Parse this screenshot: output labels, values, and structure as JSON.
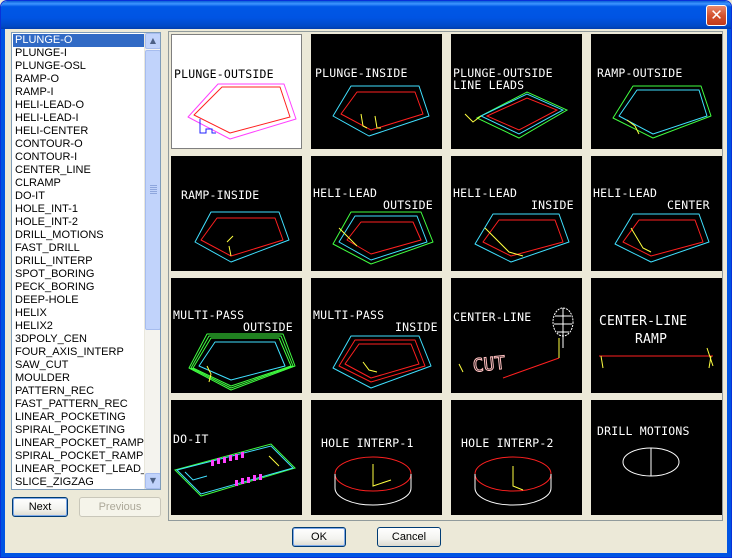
{
  "window": {
    "close_glyph": "✕"
  },
  "list": {
    "items": [
      "PLUNGE-O",
      "PLUNGE-I",
      "PLUNGE-OSL",
      "RAMP-O",
      "RAMP-I",
      "HELI-LEAD-O",
      "HELI-LEAD-I",
      "HELI-CENTER",
      "CONTOUR-O",
      "CONTOUR-I",
      "CENTER_LINE",
      "CLRAMP",
      "DO-IT",
      "HOLE_INT-1",
      "HOLE_INT-2",
      "DRILL_MOTIONS",
      "FAST_DRILL",
      "DRILL_INTERP",
      "SPOT_BORING",
      "PECK_BORING",
      "DEEP-HOLE",
      "HELIX",
      "HELIX2",
      "3DPOLY_CEN",
      "FOUR_AXIS_INTERP",
      "SAW_CUT",
      "MOULDER",
      "PATTERN_REC",
      "FAST_PATTERN_REC",
      "LINEAR_POCKETING",
      "SPIRAL_POCKETING",
      "LINEAR_POCKET_RAMP",
      "SPIRAL_POCKET_RAMP",
      "LINEAR_POCKET_LEAD_",
      "SLICE_ZIGZAG"
    ],
    "selected": "PLUNGE-O",
    "scroll_up_icon": "▲",
    "scroll_down_icon": "▼"
  },
  "buttons": {
    "next": "Next",
    "previous": "Previous",
    "ok": "OK",
    "cancel": "Cancel"
  },
  "tiles": {
    "plunge_outside": "PLUNGE-OUTSIDE",
    "plunge_inside": "PLUNGE-INSIDE",
    "plunge_outside_line_leads_1": "PLUNGE-OUTSIDE",
    "plunge_outside_line_leads_2": "LINE LEADS",
    "ramp_outside": "RAMP-OUTSIDE",
    "ramp_inside": "RAMP-INSIDE",
    "heli_lead_outside_1": "HELI-LEAD",
    "heli_lead_outside_2": "OUTSIDE",
    "heli_lead_inside_1": "HELI-LEAD",
    "heli_lead_inside_2": "INSIDE",
    "heli_lead_center_1": "HELI-LEAD",
    "heli_lead_center_2": "CENTER",
    "multi_pass_outside_1": "MULTI-PASS",
    "multi_pass_outside_2": "OUTSIDE",
    "multi_pass_inside_1": "MULTI-PASS",
    "multi_pass_inside_2": "INSIDE",
    "center_line": "CENTER-LINE",
    "center_line_cut_text": "CUT",
    "center_line_ramp_1": "CENTER-LINE",
    "center_line_ramp_2": "RAMP",
    "do_it": "DO-IT",
    "hole_interp_1": "HOLE INTERP-1",
    "hole_interp_2": "HOLE INTERP-2",
    "drill_motions": "DRILL MOTIONS"
  },
  "colors": {
    "selection": "#316ac5",
    "tile_bg": "#000000",
    "toolpath_red": "#ff2020",
    "toolpath_cyan": "#40e0ff",
    "toolpath_green": "#40ff40",
    "toolpath_yellow": "#ffff40",
    "toolpath_magenta": "#ff40ff"
  }
}
